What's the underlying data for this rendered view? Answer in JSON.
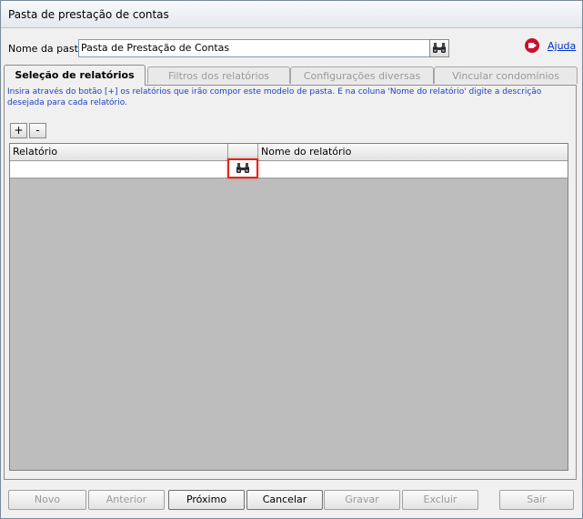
{
  "window": {
    "title": "Pasta de prestação de contas"
  },
  "header": {
    "name_label": "Nome da pasta:",
    "name_value": "Pasta de Prestação de Contas",
    "search_icon": "binoculars-icon",
    "help_icon": "record-stop-icon",
    "help_label": "Ajuda"
  },
  "tabs": [
    {
      "label": "Seleção de relatórios",
      "active": true
    },
    {
      "label": "Filtros dos relatórios",
      "active": false
    },
    {
      "label": "Configurações diversas",
      "active": false
    },
    {
      "label": "Vincular condomínios",
      "active": false
    }
  ],
  "panel": {
    "instruction": "Insira através do botão [+] os relatórios que irão compor este modelo de pasta. E na coluna 'Nome do relatório' digite a descrição desejada para cada relatório.",
    "add_label": "+",
    "remove_label": "-",
    "grid": {
      "columns": [
        "Relatório",
        "",
        "Nome do relatório"
      ],
      "rows": [
        {
          "relatorio": "",
          "nome": ""
        }
      ],
      "lookup_icon": "binoculars-icon"
    }
  },
  "footer": {
    "buttons": [
      {
        "label": "Novo",
        "enabled": false
      },
      {
        "label": "Anterior",
        "enabled": false
      },
      {
        "label": "Próximo",
        "enabled": true
      },
      {
        "label": "Cancelar",
        "enabled": true
      },
      {
        "label": "Gravar",
        "enabled": false
      },
      {
        "label": "Excluir",
        "enabled": false
      },
      {
        "label": "Sair",
        "enabled": false
      }
    ]
  },
  "colors": {
    "instruction_text": "#1f3fc2",
    "grid_background": "#bdbdbd",
    "highlight": "#e0261b",
    "help_icon": "#c8102e"
  }
}
